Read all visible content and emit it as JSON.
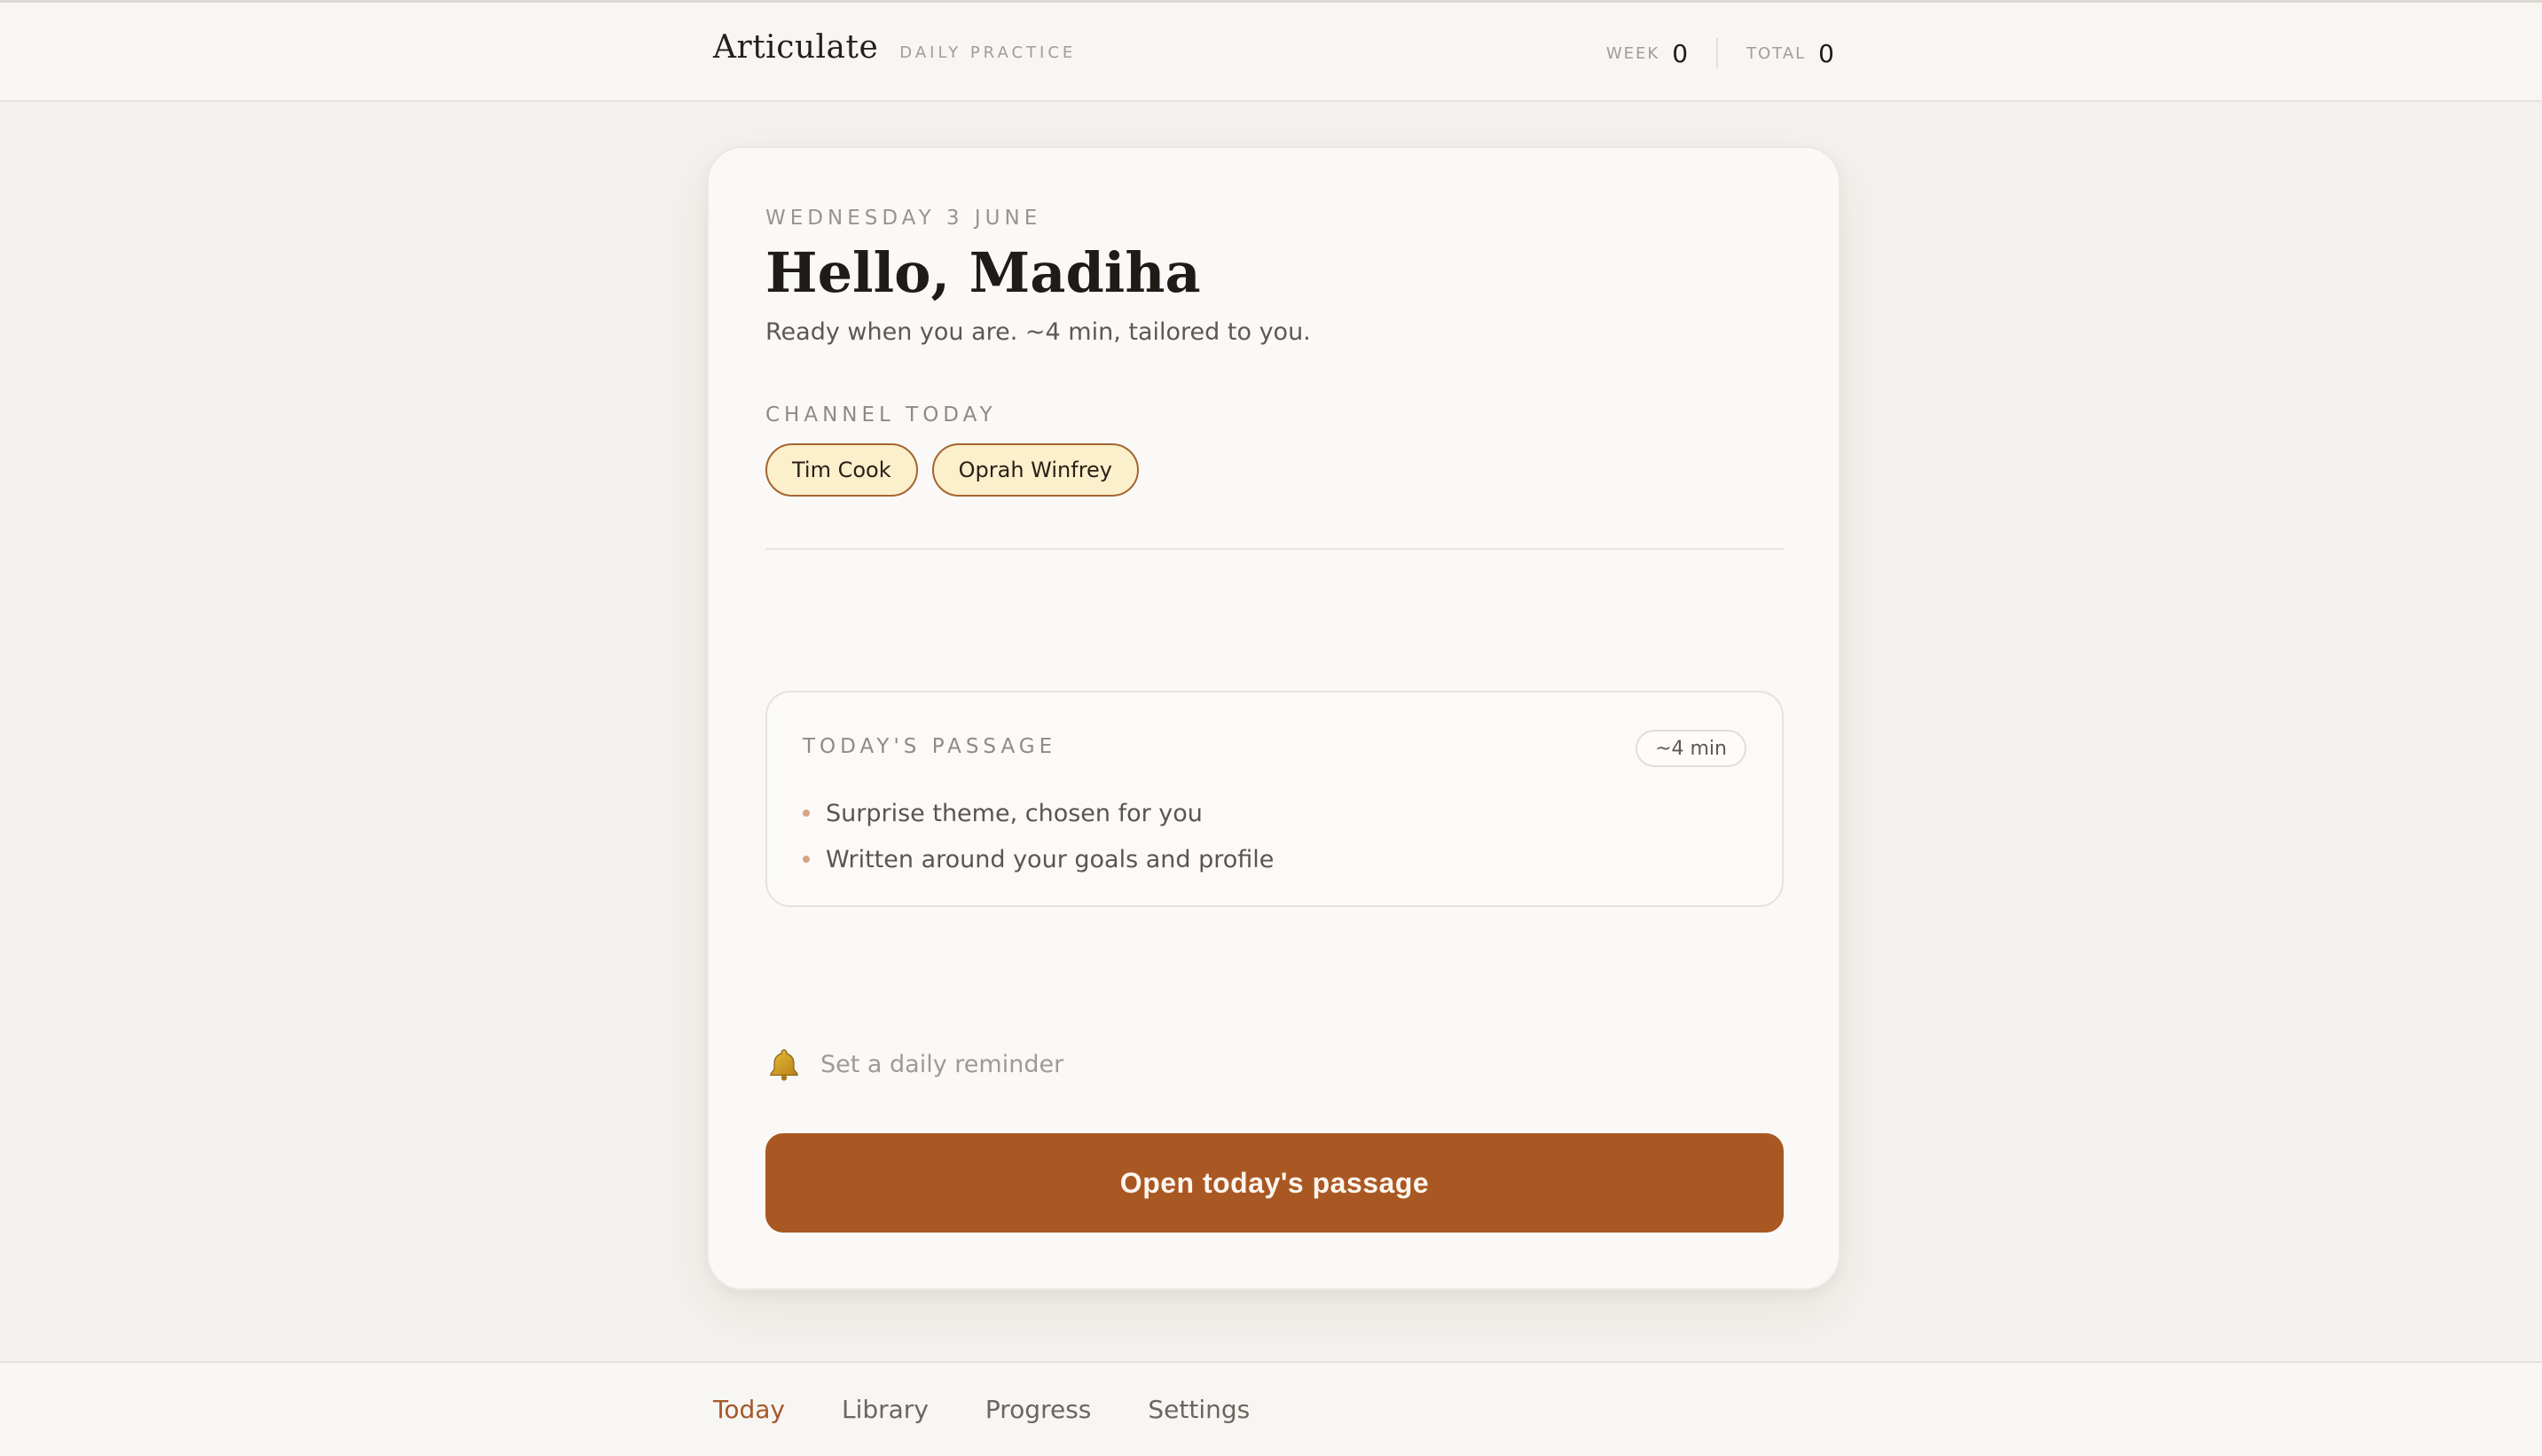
{
  "app": {
    "name": "Articulate",
    "subtitle": "DAILY PRACTICE"
  },
  "stats": {
    "week_label": "WEEK",
    "week_value": "0",
    "total_label": "TOTAL",
    "total_value": "0"
  },
  "card": {
    "date": "WEDNESDAY 3 JUNE",
    "greeting": "Hello, Madiha",
    "subtitle": "Ready when you are. ~4 min, tailored to you.",
    "channel_label": "CHANNEL TODAY",
    "channels": [
      "Tim Cook",
      "Oprah Winfrey"
    ],
    "passage": {
      "label": "TODAY'S PASSAGE",
      "duration": "~4 min",
      "points": [
        "Surprise theme, chosen for you",
        "Written around your goals and profile"
      ]
    },
    "reminder": {
      "icon": "bell-icon",
      "text": "Set a daily reminder"
    },
    "cta_label": "Open today's passage"
  },
  "nav": {
    "items": [
      "Today",
      "Library",
      "Progress",
      "Settings"
    ],
    "active": "Today"
  },
  "colors": {
    "accent": "#a95823",
    "chip_bg": "#fcefcb",
    "chip_border": "#a4652f",
    "background": "#f4f2ee",
    "card": "#faf9f7"
  }
}
